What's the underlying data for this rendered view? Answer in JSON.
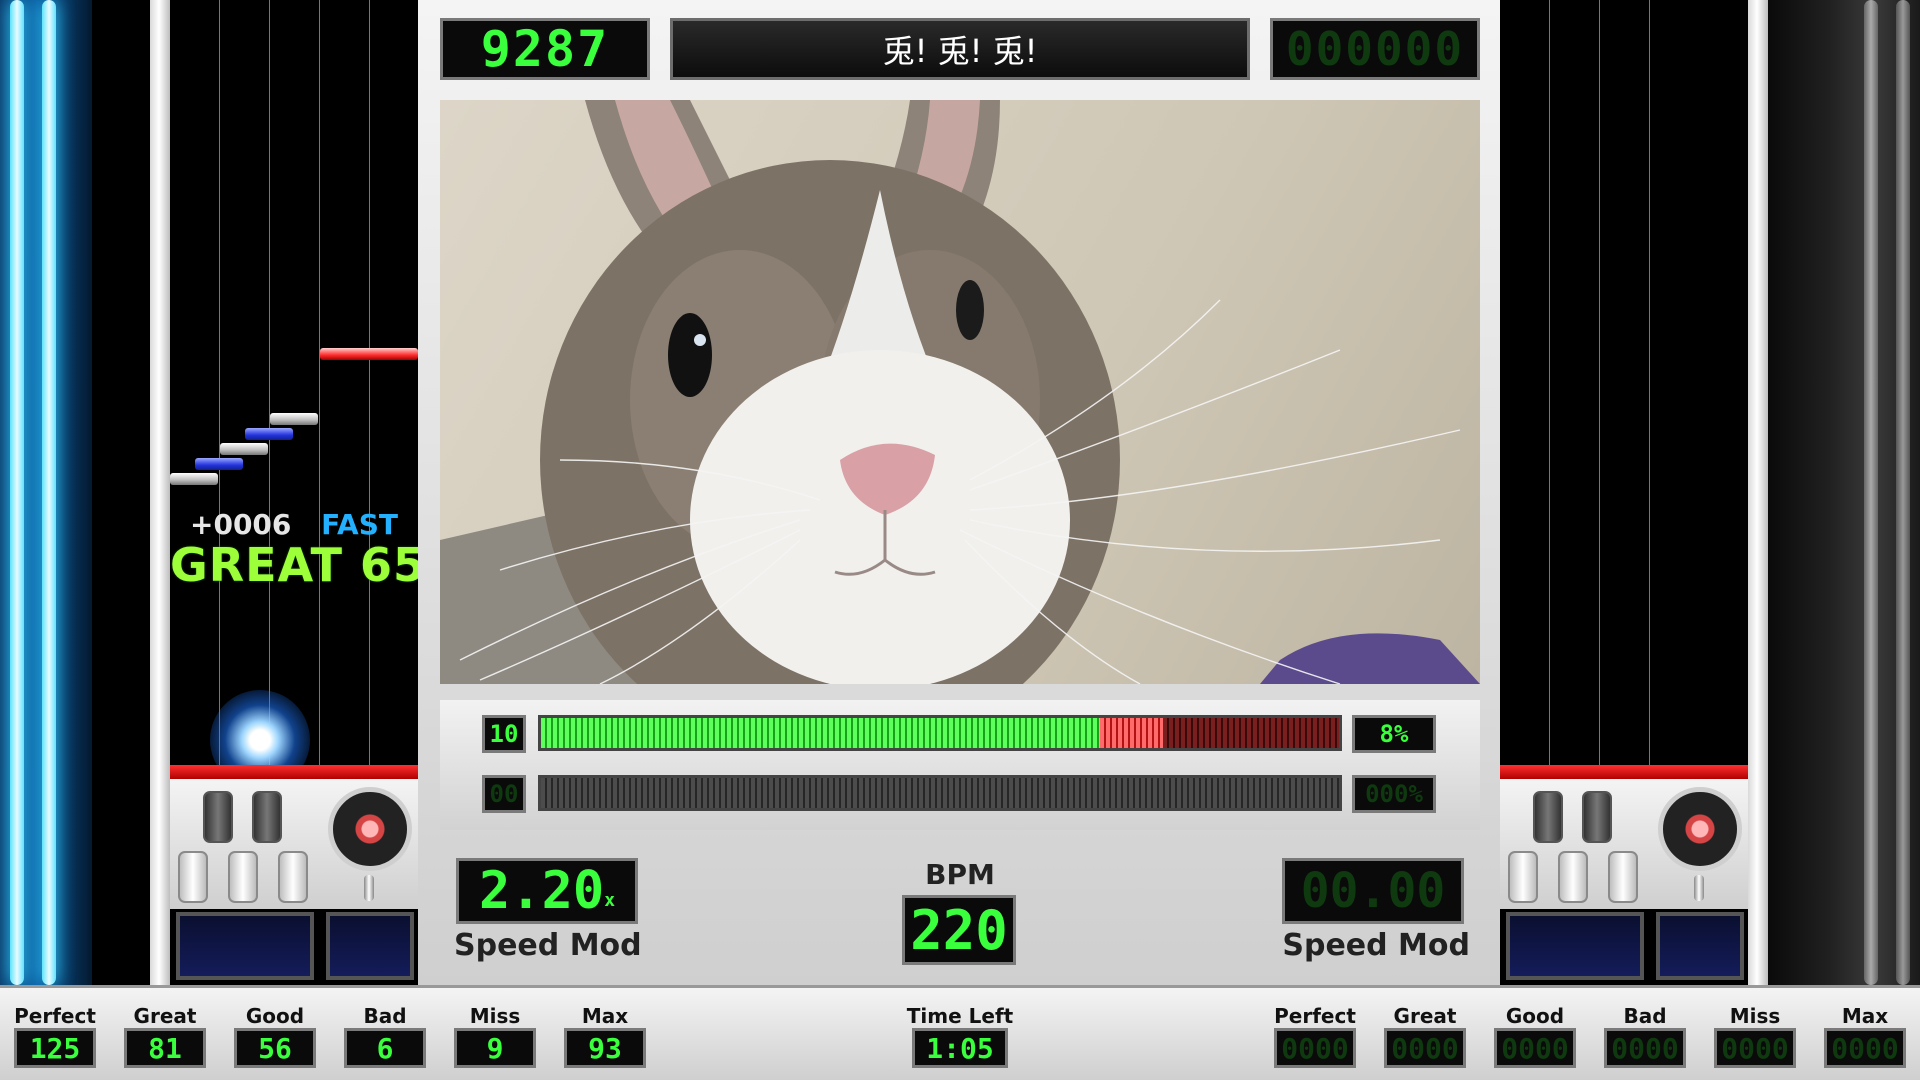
{
  "header": {
    "score_p1": "9287",
    "song_title": "兎! 兎! 兎!",
    "score_p2": "000000"
  },
  "judgement": {
    "timing_offset": "+0006",
    "timing_label": "FAST",
    "judge_text": "GREAT",
    "combo": "65"
  },
  "groove_gauge": {
    "p1_level": "10",
    "p1_percent_label": "8%",
    "p1_fill": 0.7,
    "p2_level": "00",
    "p2_percent_label": "000%",
    "p2_fill": 0.0
  },
  "center_panel": {
    "p1_speed_value": "2.20",
    "p1_speed_suffix": "x",
    "p1_speed_label": "Speed Mod",
    "bpm_label": "BPM",
    "bpm_value": "220",
    "p2_speed_value": "00.00",
    "p2_speed_label": "Speed Mod"
  },
  "stats_p1": [
    {
      "label": "Perfect",
      "value": "125"
    },
    {
      "label": "Great",
      "value": "81"
    },
    {
      "label": "Good",
      "value": "56"
    },
    {
      "label": "Bad",
      "value": "6"
    },
    {
      "label": "Miss",
      "value": "9"
    },
    {
      "label": "Max Combo",
      "value": "93"
    }
  ],
  "time_left": {
    "label": "Time Left",
    "value": "1:05"
  },
  "stats_p2": [
    {
      "label": "Perfect",
      "value": "0000"
    },
    {
      "label": "Great",
      "value": "0000"
    },
    {
      "label": "Good",
      "value": "0000"
    },
    {
      "label": "Bad",
      "value": "0000"
    },
    {
      "label": "Miss",
      "value": "0000"
    },
    {
      "label": "Max Combo",
      "value": "0000"
    }
  ],
  "colors": {
    "lcd_green": "#39ff3c",
    "neon_cyan": "#34d3ff",
    "judge_green": "#9cff3a",
    "fast_blue": "#23b0ff",
    "gauge_green": "#2fe02f",
    "gauge_red": "#e02020"
  },
  "video": {
    "subject": "rabbit-closeup"
  }
}
